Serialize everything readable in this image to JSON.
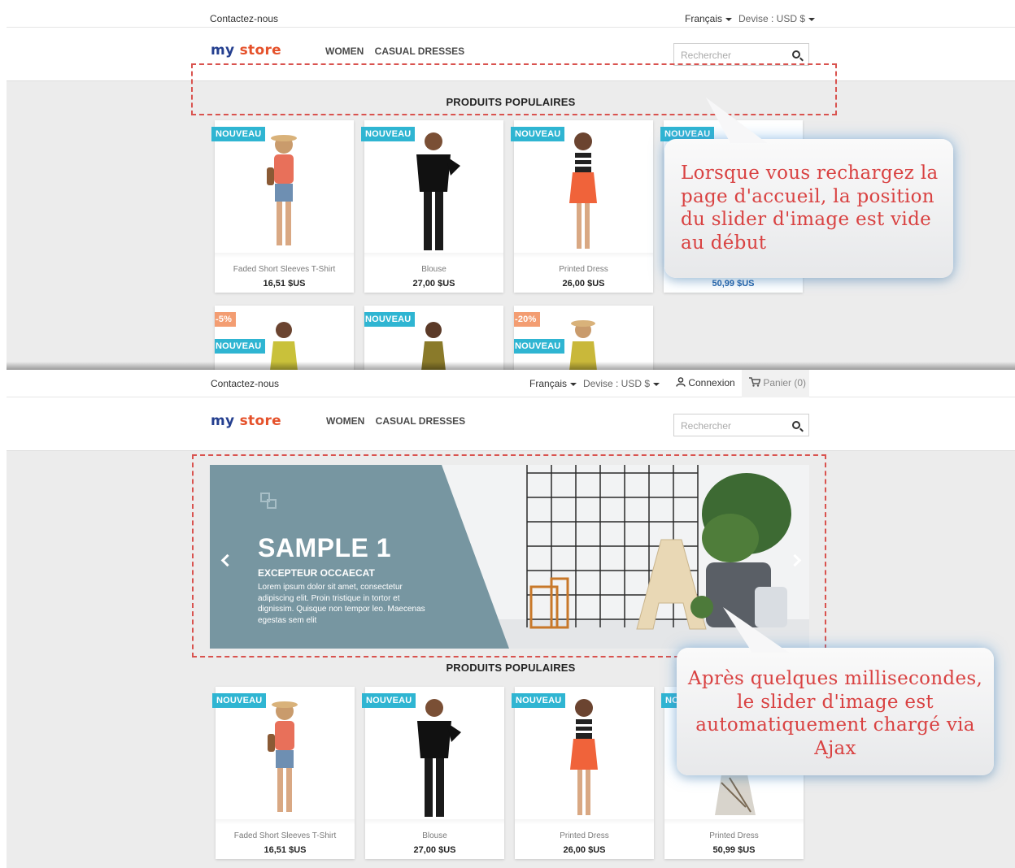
{
  "colors": {
    "accent": "#2fb5d2",
    "discount": "#f39d72",
    "dashed_outline": "#d9534f",
    "callout_text": "#d94242",
    "slider_panel": "#7796a1",
    "logo_primary": "#243f8f",
    "logo_secondary": "#e5512a"
  },
  "top_state": {
    "topbar": {
      "contact": "Contactez-nous",
      "language": "Français",
      "currency": "Devise : USD $"
    },
    "header": {
      "logo_part1": "my",
      "logo_part2": "store",
      "nav": [
        "WOMEN",
        "CASUAL DRESSES"
      ],
      "search_placeholder": "Rechercher",
      "search_icon": "search-icon"
    },
    "section_title": "PRODUITS POPULAIRES",
    "products": [
      {
        "badge": "NOUVEAU",
        "name": "Faded Short Sleeves T-Shirt",
        "price": "16,51 $US"
      },
      {
        "badge": "NOUVEAU",
        "name": "Blouse",
        "price": "27,00 $US"
      },
      {
        "badge": "NOUVEAU",
        "name": "Printed Dress",
        "price": "26,00 $US"
      },
      {
        "badge": "NOUVEAU",
        "price": "50,99 $US"
      }
    ],
    "second_row": [
      {
        "discount": "-5%",
        "badge": "NOUVEAU"
      },
      {
        "badge": "NOUVEAU"
      },
      {
        "discount": "-20%",
        "badge": "NOUVEAU"
      }
    ],
    "callout": [
      "Lorsque vous rechargez la",
      "page d'accueil, la position",
      "du slider d'image est vide",
      "au début"
    ]
  },
  "bottom_state": {
    "topbar": {
      "contact": "Contactez-nous",
      "language": "Français",
      "currency": "Devise : USD $",
      "login": "Connexion",
      "login_icon": "user-icon",
      "cart": "Panier (0)",
      "cart_icon": "cart-icon"
    },
    "header": {
      "logo_part1": "my",
      "logo_part2": "store",
      "nav": [
        "WOMEN",
        "CASUAL DRESSES"
      ],
      "search_placeholder": "Rechercher",
      "search_icon": "search-icon"
    },
    "slider": {
      "title": "SAMPLE 1",
      "subtitle": "EXCEPTEUR OCCAECAT",
      "text_lines": [
        "Lorem ipsum dolor sit amet, consectetur",
        "adipiscing elit. Proin tristique in tortor et",
        "dignissim. Quisque non tempor leo. Maecenas",
        "egestas sem elit"
      ],
      "prev_icon": "chevron-left-icon",
      "next_icon": "chevron-right-icon"
    },
    "section_title": "PRODUITS POPULAIRES",
    "products": [
      {
        "badge": "NOUVEAU",
        "name": "Faded Short Sleeves T-Shirt",
        "price": "16,51 $US"
      },
      {
        "badge": "NOUVEAU",
        "name": "Blouse",
        "price": "27,00 $US"
      },
      {
        "badge": "NOUVEAU",
        "name": "Printed Dress",
        "price": "26,00 $US"
      },
      {
        "badge": "NO",
        "name": "Printed Dress",
        "price": "50,99 $US"
      }
    ],
    "callout": [
      "Après quelques millisecondes,",
      "le slider d'image est",
      "automatiquement chargé via",
      "Ajax"
    ]
  }
}
